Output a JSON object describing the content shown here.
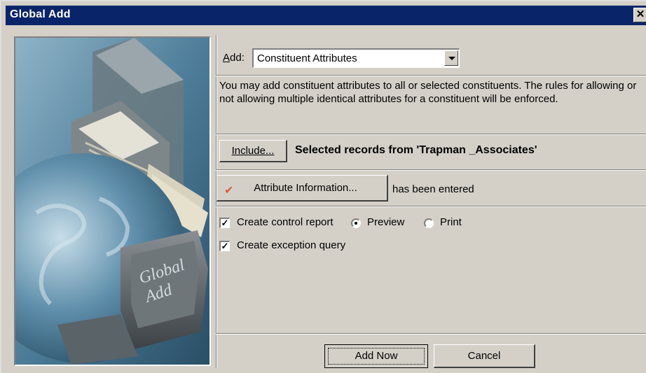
{
  "window": {
    "title": "Global Add",
    "close_glyph": "✕"
  },
  "image": {
    "keycap_line1": "Global",
    "keycap_line2": "Add"
  },
  "add": {
    "label_accel": "A",
    "label_rest": "dd:",
    "selected": "Constituent Attributes"
  },
  "description": "You may add constituent attributes to all or selected constituents.  The rules for allowing or not allowing multiple identical attributes for a constituent will be enforced.",
  "include": {
    "button_label": "Include...",
    "status": "Selected records from 'Trapman _Associates'"
  },
  "attribute": {
    "check_glyph": "✔",
    "button_label": "Attribute Information...",
    "status": "has been entered"
  },
  "options": {
    "control_report": {
      "label": "Create control report",
      "checked": true
    },
    "preview": {
      "label": "Preview",
      "selected": true
    },
    "print": {
      "label": "Print",
      "selected": false
    },
    "exception_query": {
      "label": "Create exception query",
      "checked": true
    }
  },
  "buttons": {
    "add_now": "Add Now",
    "cancel": "Cancel"
  },
  "icons": {
    "close": "close-icon",
    "dropdown": "chevron-down-icon",
    "check": "check-icon"
  },
  "colors": {
    "titlebar": "#0a246a",
    "face": "#d4d0c8",
    "checkmark": "#e05a3c"
  }
}
